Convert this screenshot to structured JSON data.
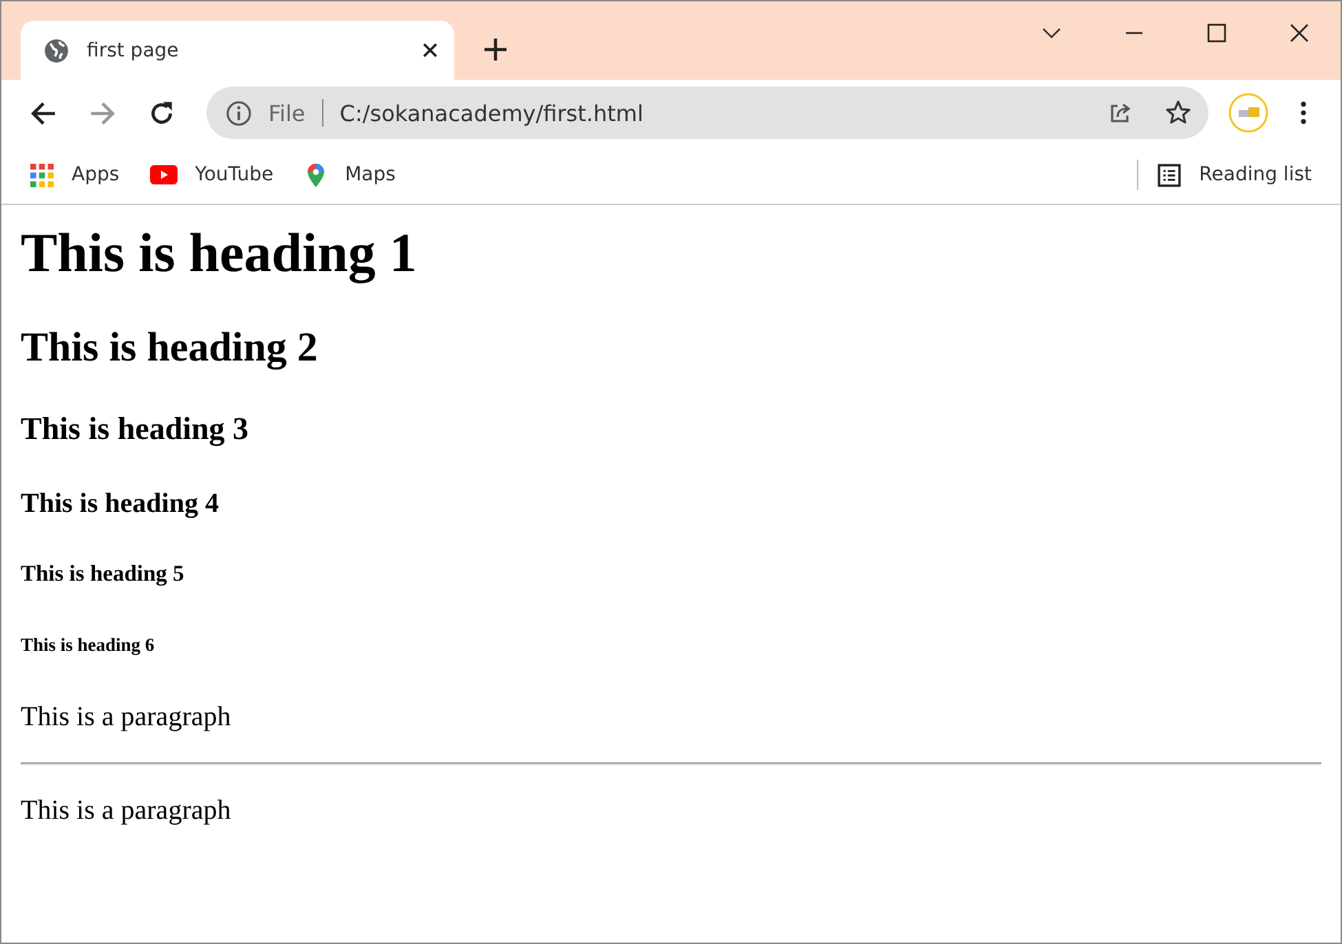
{
  "tab": {
    "title": "first page"
  },
  "address_bar": {
    "scheme": "File",
    "url": "C:/sokanacademy/first.html"
  },
  "bookmarks": [
    {
      "label": "Apps",
      "kind": "apps"
    },
    {
      "label": "YouTube",
      "kind": "youtube"
    },
    {
      "label": "Maps",
      "kind": "maps"
    }
  ],
  "reading_list": "Reading list",
  "page": [
    {
      "kind": "h1",
      "text": "This is heading 1"
    },
    {
      "kind": "h2",
      "text": "This is heading 2"
    },
    {
      "kind": "h3",
      "text": "This is heading 3"
    },
    {
      "kind": "h4",
      "text": "This is heading 4"
    },
    {
      "kind": "h5",
      "text": "This is heading 5"
    },
    {
      "kind": "h6",
      "text": "This is heading 6"
    },
    {
      "kind": "p",
      "text": "This is a paragraph"
    },
    {
      "kind": "hr"
    },
    {
      "kind": "p",
      "text": "This is a paragraph"
    }
  ]
}
